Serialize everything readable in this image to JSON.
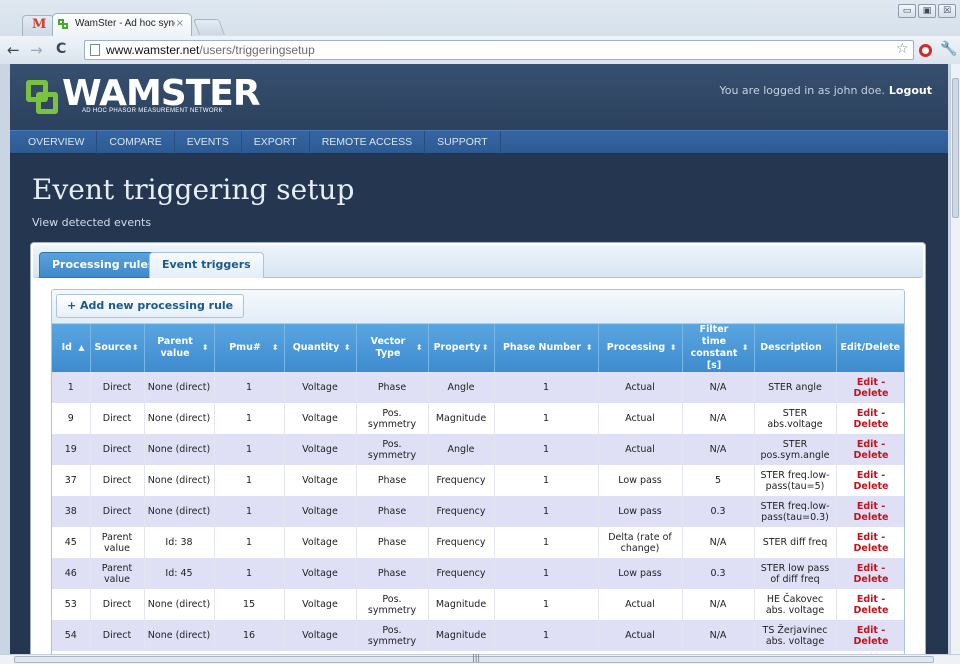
{
  "browser": {
    "tab_gmail": "M",
    "tab_title": "WamSter - Ad hoc synchro",
    "tab_close": "×",
    "url_host": "www.wamster.net",
    "url_path": "/users/triggeringsetup",
    "back": "←",
    "forward": "→",
    "reload": "C",
    "star": "☆",
    "wrench": "🔧",
    "win_min": "▭",
    "win_max": "▣",
    "win_close": "☒"
  },
  "site": {
    "logo_text": "WAMSTER",
    "logo_subtitle": "AD HOC PHASOR MEASUREMENT NETWORK",
    "login_text": "You are logged in as john doe.",
    "logout": "Logout",
    "menu": [
      "OVERVIEW",
      "COMPARE",
      "EVENTS",
      "EXPORT",
      "REMOTE ACCESS",
      "SUPPORT"
    ]
  },
  "page": {
    "title": "Event triggering setup",
    "sub_link": "View detected events",
    "tabs": [
      "Processing rules",
      "Event triggers"
    ],
    "add_button": "+  Add new processing rule"
  },
  "table": {
    "headers": [
      {
        "label": "Id",
        "sort": "▲"
      },
      {
        "label": "Source",
        "sort": "⬍"
      },
      {
        "label": "Parent value",
        "sort": "⬍"
      },
      {
        "label": "Pmu#",
        "sort": "⬍"
      },
      {
        "label": "Quantity",
        "sort": "⬍"
      },
      {
        "label": "Vector Type",
        "sort": "⬍"
      },
      {
        "label": "Property",
        "sort": "⬍"
      },
      {
        "label": "Phase Number",
        "sort": "⬍"
      },
      {
        "label": "Processing",
        "sort": "⬍"
      },
      {
        "label": "Filter time constant [s]",
        "sort": "⬍"
      },
      {
        "label": "Description",
        "sort": ""
      },
      {
        "label": "Edit/Delete",
        "sort": ""
      }
    ],
    "rows": [
      [
        "1",
        "Direct",
        "None (direct)",
        "1",
        "Voltage",
        "Phase",
        "Angle",
        "1",
        "Actual",
        "N/A",
        "STER angle",
        "Edit - Delete"
      ],
      [
        "9",
        "Direct",
        "None (direct)",
        "1",
        "Voltage",
        "Pos. symmetry",
        "Magnitude",
        "1",
        "Actual",
        "N/A",
        "STER abs.voltage",
        "Edit - Delete"
      ],
      [
        "19",
        "Direct",
        "None (direct)",
        "1",
        "Voltage",
        "Pos. symmetry",
        "Angle",
        "1",
        "Actual",
        "N/A",
        "STER pos.sym.angle",
        "Edit - Delete"
      ],
      [
        "37",
        "Direct",
        "None (direct)",
        "1",
        "Voltage",
        "Phase",
        "Frequency",
        "1",
        "Low pass",
        "5",
        "STER freq.low-pass(tau=5)",
        "Edit - Delete"
      ],
      [
        "38",
        "Direct",
        "None (direct)",
        "1",
        "Voltage",
        "Phase",
        "Frequency",
        "1",
        "Low pass",
        "0.3",
        "STER freq.low-pass(tau=0.3)",
        "Edit - Delete"
      ],
      [
        "45",
        "Parent value",
        "Id: 38",
        "1",
        "Voltage",
        "Phase",
        "Frequency",
        "1",
        "Delta (rate of change)",
        "N/A",
        "STER diff freq",
        "Edit - Delete"
      ],
      [
        "46",
        "Parent value",
        "Id: 45",
        "1",
        "Voltage",
        "Phase",
        "Frequency",
        "1",
        "Low pass",
        "0.3",
        "STER low pass of diff freq",
        "Edit - Delete"
      ],
      [
        "53",
        "Direct",
        "None (direct)",
        "15",
        "Voltage",
        "Pos. symmetry",
        "Magnitude",
        "1",
        "Actual",
        "N/A",
        "HE Čakovec abs. voltage",
        "Edit - Delete"
      ],
      [
        "54",
        "Direct",
        "None (direct)",
        "16",
        "Voltage",
        "Pos. symmetry",
        "Magnitude",
        "1",
        "Actual",
        "N/A",
        "TS Žerjavinec abs. voltage",
        "Edit - Delete"
      ]
    ]
  },
  "colors": {
    "header_bg": "#2b415d",
    "menu_bg": "#2d5a92",
    "table_header": "#4a97d7",
    "row_alt": "#dfe0f6",
    "action_red": "#c5121b",
    "logo_green": "#7bc242"
  }
}
